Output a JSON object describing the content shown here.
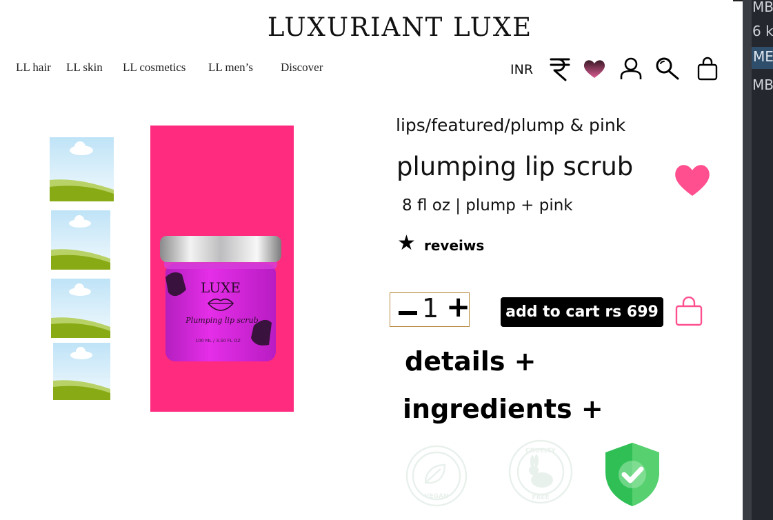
{
  "brand": {
    "name": "LUXURIANT LUXE"
  },
  "nav": {
    "items": [
      {
        "label": "LL hair"
      },
      {
        "label": "LL skin"
      },
      {
        "label": "LL cosmetics"
      },
      {
        "label": "LL men’s"
      },
      {
        "label": "Discover"
      }
    ]
  },
  "header": {
    "currency_code": "INR",
    "icons": [
      "rupee-icon",
      "heart-icon",
      "user-icon",
      "search-icon",
      "shopping-bag-icon"
    ]
  },
  "gallery": {
    "thumbnails": [
      "image-placeholder",
      "image-placeholder",
      "image-placeholder",
      "image-placeholder"
    ],
    "hero": {
      "background": "#fe2b7e",
      "jar_brand": "LUXE",
      "jar_label": "Plumping lip scrub",
      "jar_volume": "100 ML / 3.50 FL OZ"
    }
  },
  "product": {
    "breadcrumb": "lips/featured/plump & pink",
    "title": "plumping lip scrub",
    "subtitle": "8 fl oz | plump + pink",
    "reviews_label": "reveiws",
    "quantity": "1",
    "add_to_cart_label": "add to cart rs 699",
    "accent_color": "#ff4f8f"
  },
  "accordions": [
    {
      "label": "details  +"
    },
    {
      "label": "ingredients +"
    }
  ],
  "badges": {
    "vegan": "VEGAN",
    "cruelty_free_top": "CRUELTY",
    "cruelty_free_bottom": "FREE",
    "verified_color": "#2fbf55"
  },
  "side_panel": {
    "rows": [
      "MB",
      "6 k",
      "ME",
      "MB"
    ]
  }
}
